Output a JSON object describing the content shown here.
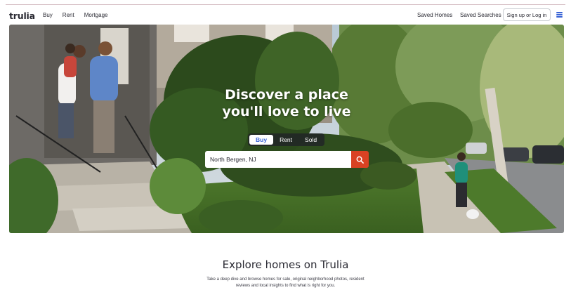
{
  "header": {
    "logo": "trulia",
    "nav": [
      "Buy",
      "Rent",
      "Mortgage"
    ],
    "saved_homes": "Saved Homes",
    "saved_searches": "Saved Searches",
    "signup": "Sign up or Log in",
    "menu_icon": "hamburger-menu-icon"
  },
  "hero": {
    "title_line1": "Discover a place",
    "title_line2": "you'll love to live",
    "tabs": [
      {
        "label": "Buy",
        "active": true
      },
      {
        "label": "Rent",
        "active": false
      },
      {
        "label": "Sold",
        "active": false
      }
    ],
    "search_value": "North Bergen, NJ",
    "search_icon": "search-icon"
  },
  "explore": {
    "title": "Explore homes on Trulia",
    "desc_line1": "Take a deep dive and browse homes for sale, original neighborhood photos, resident",
    "desc_line2": "reviews and local insights to find what is right for you."
  },
  "colors": {
    "accent_blue": "#3b65d6",
    "search_button": "#d94223",
    "text": "#2a2a33"
  }
}
